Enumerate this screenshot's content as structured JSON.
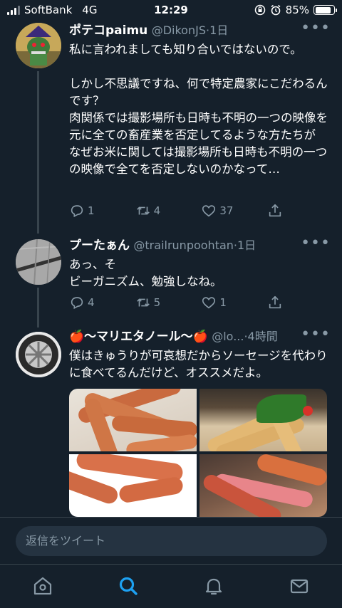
{
  "status_bar": {
    "carrier": "SoftBank",
    "network": "4G",
    "time": "12:29",
    "battery": "85%",
    "battery_level": 0.85
  },
  "tweets": [
    {
      "name": "ポテコpaimu",
      "handle": "@DikonJS",
      "time": "1日",
      "text": "私に言われましても知り合いではないので。\n\nしかし不思議ですね、何で特定農家にこだわるんです？\n肉関係では撮影場所も日時も不明の一つの映像を元に全ての畜産業を否定してるような方たちが\nなぜお米に関しては撮影場所も日時も不明の一つの映像で全てを否定しないのかなって…",
      "replies": "1",
      "retweets": "4",
      "likes": "37"
    },
    {
      "name": "プーたぁん",
      "handle": "@trailrunpoohtan",
      "time": "1日",
      "text": "あっ、そ\nビーガニズム、勉強しなね。",
      "replies": "4",
      "retweets": "5",
      "likes": "1"
    },
    {
      "name": "🍎〜マリエタノール〜🍎",
      "handle": "@lo...",
      "time": "4時間",
      "text": "僕はきゅうりが可哀想だからソーセージを代わりに食べてるんだけど、オススメだよ。"
    }
  ],
  "reply_placeholder": "返信をツイート",
  "tabs": [
    "home",
    "search",
    "notifications",
    "messages"
  ],
  "colors": {
    "background": "#15202b",
    "secondary_text": "#8899a6",
    "accent": "#1da1f2",
    "divider": "#38444d"
  }
}
